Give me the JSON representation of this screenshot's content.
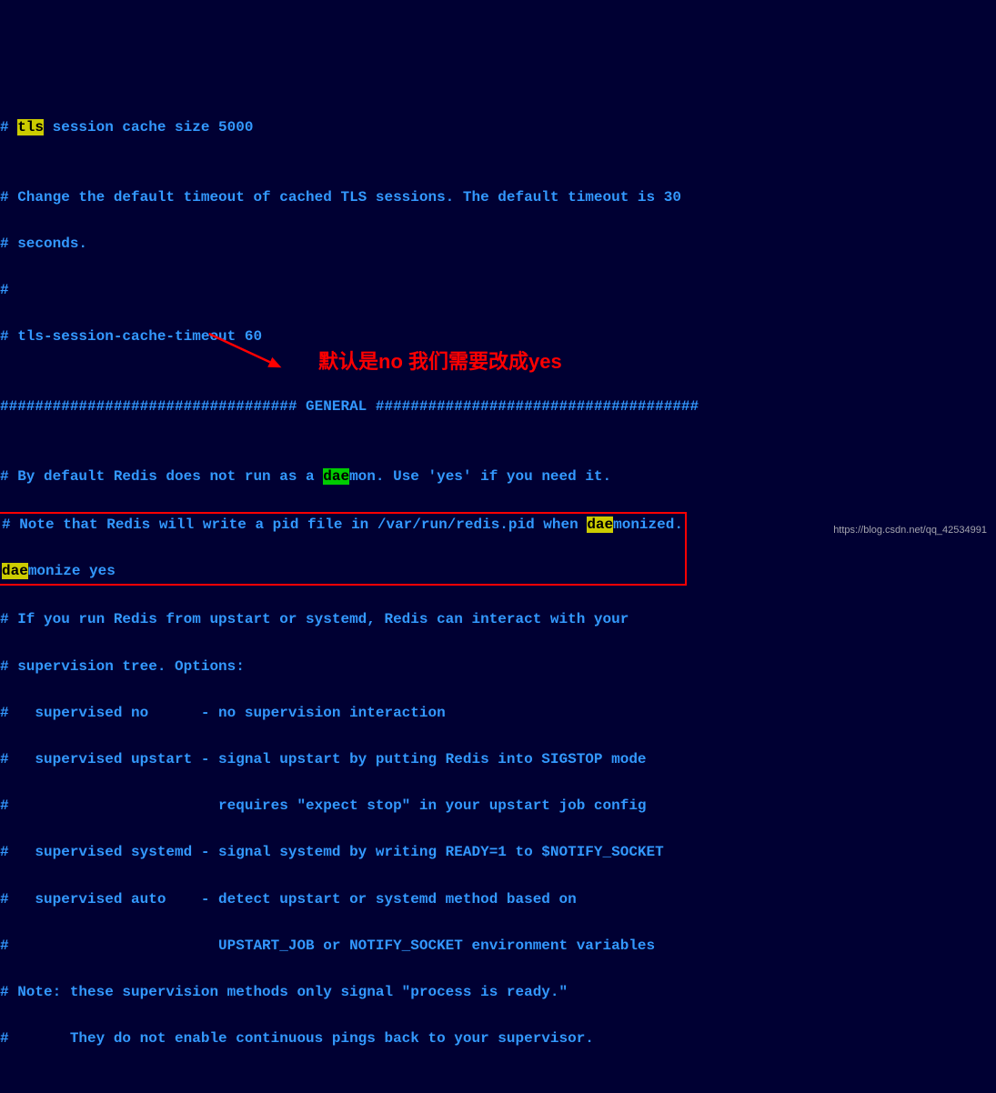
{
  "lines": {
    "l0_pre": "# ",
    "l0_post": " session cache size 5000",
    "l1": "",
    "l2": "# Change the default timeout of cached TLS sessions. The default timeout is 30",
    "l3": "# seconds.",
    "l4": "#",
    "l5": "# tls-session-cache-timeout 60",
    "l6": "",
    "l7": "################################## GENERAL #####################################",
    "l8": "",
    "l9a": "# By default Redis does not run as a ",
    "l9b": "dae",
    "l9c": "mon. Use 'yes' if you need it.",
    "l10a": "# Note that Redis will write a pid file in /var/run/redis.pid when ",
    "l10b": "dae",
    "l10c": "monized.",
    "l11a": "dae",
    "l11b": "monize yes",
    "l12": "",
    "l13": "# If you run Redis from upstart or systemd, Redis can interact with your",
    "l14": "# supervision tree. Options:",
    "l15": "#   supervised no      - no supervision interaction",
    "l16": "#   supervised upstart - signal upstart by putting Redis into SIGSTOP mode",
    "l17": "#                        requires \"expect stop\" in your upstart job config",
    "l18": "#   supervised systemd - signal systemd by writing READY=1 to $NOTIFY_SOCKET",
    "l19": "#   supervised auto    - detect upstart or systemd method based on",
    "l20": "#                        UPSTART_JOB or NOTIFY_SOCKET environment variables",
    "l21": "# Note: these supervision methods only signal \"process is ready.\"",
    "l22": "#       They do not enable continuous pings back to your supervisor."
  },
  "highlight": {
    "token": "dae",
    "tls": "tls"
  },
  "annotation": {
    "text": "默认是no  我们需要改成yes",
    "arrow": "⟶"
  },
  "watermark": "https://blog.csdn.net/qq_42534991"
}
